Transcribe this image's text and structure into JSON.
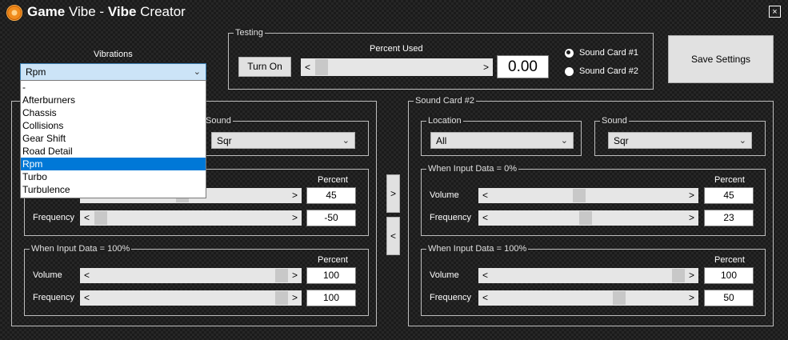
{
  "window": {
    "title_bold_1": "Game",
    "title_mid": " Vibe - ",
    "title_bold_2": "Vibe",
    "title_end": " Creator",
    "close_glyph": "×"
  },
  "vibrations": {
    "label": "Vibrations",
    "selected": "Rpm",
    "options": [
      "-",
      "Afterburners",
      "Chassis",
      "Collisions",
      "Gear Shift",
      "Road Detail",
      "Rpm",
      "Turbo",
      "Turbulence"
    ],
    "selected_index": 6
  },
  "testing": {
    "group_label": "Testing",
    "button": "Turn On",
    "percent_label": "Percent Used",
    "value": "0.00",
    "scroll_position": 0.0,
    "sound_card_1": "Sound Card #1",
    "sound_card_2": "Sound Card #2",
    "selected_card": 1
  },
  "save_button": "Save Settings",
  "arrows": {
    "right": ">",
    "left": "<"
  },
  "card1": {
    "group_label_hidden": "Sound Card #1",
    "sound_label": "Sound",
    "sound_value": "Sqr",
    "percent_label": "Percent",
    "zero": {
      "volume": "45",
      "frequency": "-50",
      "volume_pos": 0.45,
      "frequency_pos": 0.0
    },
    "full": {
      "group_label": "When Input Data = 100%",
      "percent_label": "Percent",
      "volume_label": "Volume",
      "frequency_label": "Frequency",
      "volume": "100",
      "frequency": "100",
      "volume_pos": 1.0,
      "frequency_pos": 1.0
    },
    "frequency_label": "Frequency"
  },
  "card2": {
    "group_label": "Sound Card #2",
    "location_label": "Location",
    "location_value": "All",
    "sound_label": "Sound",
    "sound_value": "Sqr",
    "zero": {
      "group_label": "When Input Data = 0%",
      "percent_label": "Percent",
      "volume_label": "Volume",
      "frequency_label": "Frequency",
      "volume": "45",
      "frequency": "23",
      "volume_pos": 0.45,
      "frequency_pos": 0.5
    },
    "full": {
      "group_label": "When Input Data = 100%",
      "percent_label": "Percent",
      "volume_label": "Volume",
      "frequency_label": "Frequency",
      "volume": "100",
      "frequency": "50",
      "volume_pos": 1.0,
      "frequency_pos": 0.65
    }
  },
  "scroll_arrows": {
    "left": "<",
    "right": ">"
  },
  "combo_arrow": "⌄"
}
